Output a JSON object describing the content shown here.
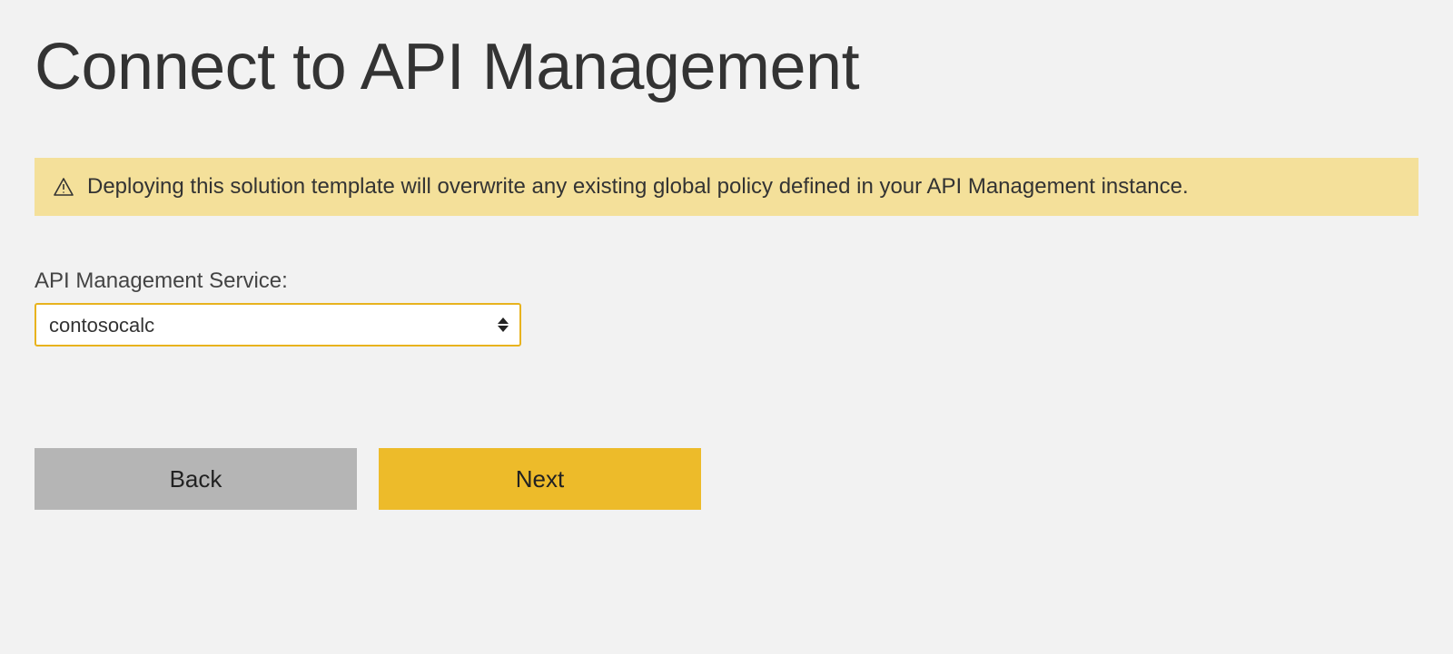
{
  "page": {
    "title": "Connect to API Management"
  },
  "warning": {
    "text": "Deploying this solution template will overwrite any existing global policy defined in your API Management instance."
  },
  "form": {
    "service_label": "API Management Service:",
    "service_selected": "contosocalc"
  },
  "buttons": {
    "back": "Back",
    "next": "Next"
  }
}
